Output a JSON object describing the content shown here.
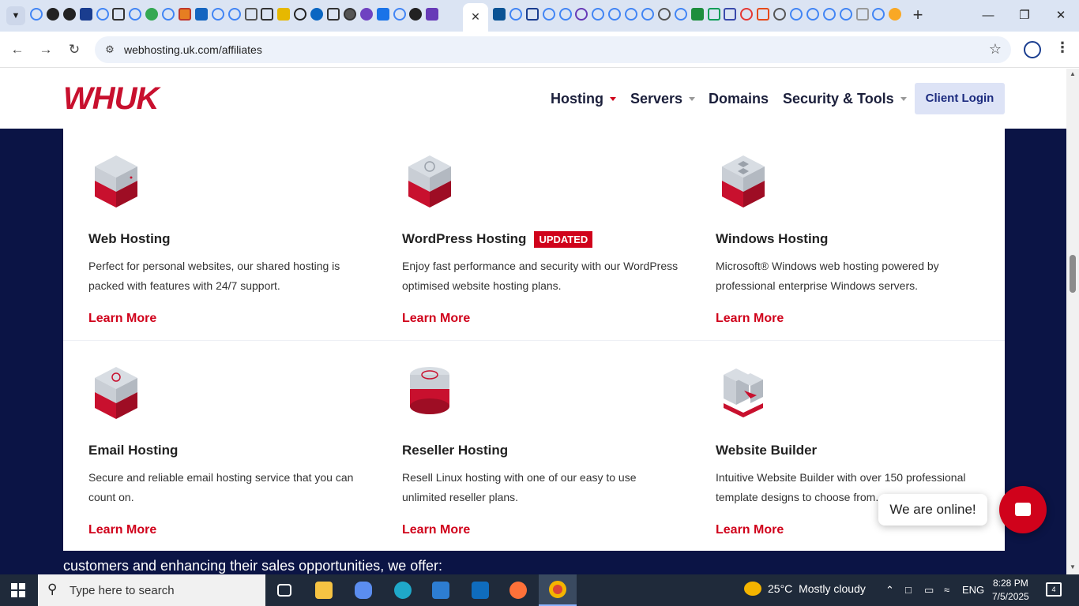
{
  "browser": {
    "url": "webhosting.uk.com/affiliates",
    "tab_close_glyph": "✕",
    "new_tab_glyph": "+",
    "window_controls": {
      "minimize": "—",
      "maximize": "❐",
      "close": "✕"
    }
  },
  "site": {
    "logo_text": "WHUK",
    "nav": [
      {
        "label": "Hosting",
        "has_caret": true,
        "active": true
      },
      {
        "label": "Servers",
        "has_caret": true
      },
      {
        "label": "Domains",
        "has_caret": false
      },
      {
        "label": "Security & Tools",
        "has_caret": true
      }
    ],
    "login_label": "Client Login",
    "accent_color": "#d0021b",
    "navy_color": "#0b1445"
  },
  "mega_menu": {
    "cards": [
      {
        "title": "Web Hosting",
        "badge": "",
        "desc": "Perfect for personal websites, our shared hosting is packed with features with 24/7 support.",
        "link": "Learn More",
        "icon": "server-stack-icon"
      },
      {
        "title": "WordPress Hosting",
        "badge": "UPDATED",
        "desc": "Enjoy fast performance and security with our WordPress optimised website hosting plans.",
        "link": "Learn More",
        "icon": "wordpress-server-icon"
      },
      {
        "title": "Windows Hosting",
        "badge": "",
        "desc": "Microsoft® Windows web hosting powered by professional enterprise Windows servers.",
        "link": "Learn More",
        "icon": "windows-server-icon"
      },
      {
        "title": "Email Hosting",
        "badge": "",
        "desc": "Secure and reliable email hosting service that you can count on.",
        "link": "Learn More",
        "icon": "email-server-icon"
      },
      {
        "title": "Reseller Hosting",
        "badge": "",
        "desc": "Resell Linux hosting with one of our easy to use unlimited reseller plans.",
        "link": "Learn More",
        "icon": "reseller-pound-icon"
      },
      {
        "title": "Website Builder",
        "badge": "",
        "desc": "Intuitive Website Builder with over 150 professional template designs to choose from.",
        "link": "Learn More",
        "icon": "website-builder-icon"
      }
    ]
  },
  "page_text": {
    "below_menu": "customers and enhancing their sales opportunities, we offer:"
  },
  "chat": {
    "bubble_text": "We are online!"
  },
  "taskbar": {
    "search_placeholder": "Type here to search",
    "weather_temp": "25°C",
    "weather_desc": "Mostly cloudy",
    "language": "ENG",
    "time": "8:28 PM",
    "date": "7/5/2025",
    "notification_count": "4"
  }
}
